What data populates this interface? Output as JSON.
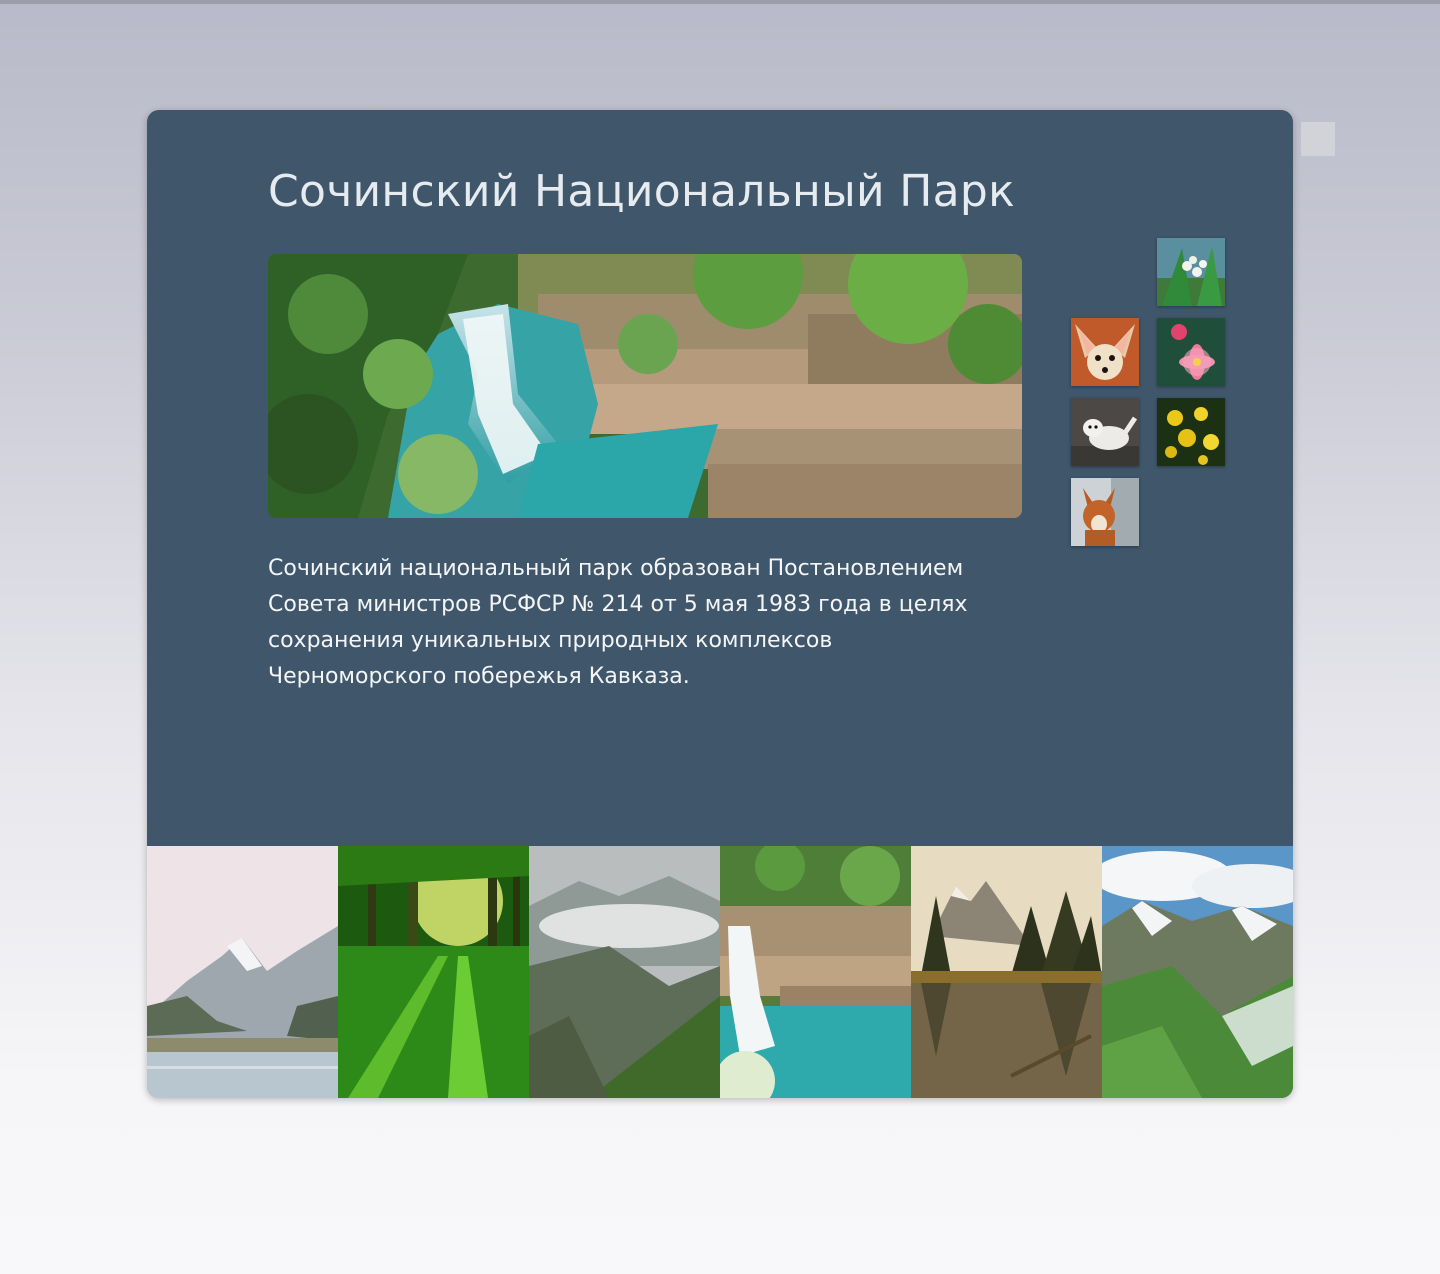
{
  "page": {
    "title": "Сочинский Национальный Парк",
    "description": "Сочинский национальный парк образован Постановлением Совета министров РСФСР № 214 от 5 мая 1983 года в целях сохранения уникальных природных комплексов Черноморского побережья Кавказа."
  },
  "hero_image": {
    "subject": "waterfall-in-canyon"
  },
  "thumbnails": [
    {
      "subject": "lily-of-the-valley"
    },
    {
      "subject": "fennec-fox"
    },
    {
      "subject": "pink-lily-flower"
    },
    {
      "subject": "white-ermine"
    },
    {
      "subject": "yellow-buttercups"
    },
    {
      "subject": "red-wolf"
    }
  ],
  "gallery_strip": [
    {
      "subject": "mountain-lake"
    },
    {
      "subject": "sunlit-forest"
    },
    {
      "subject": "misty-mountains"
    },
    {
      "subject": "waterfall"
    },
    {
      "subject": "forest-lake"
    },
    {
      "subject": "alpine-valley"
    }
  ],
  "colors": {
    "card_background": "#3f566b",
    "title_text": "#e6ebef",
    "body_text": "#f3f5f7"
  }
}
